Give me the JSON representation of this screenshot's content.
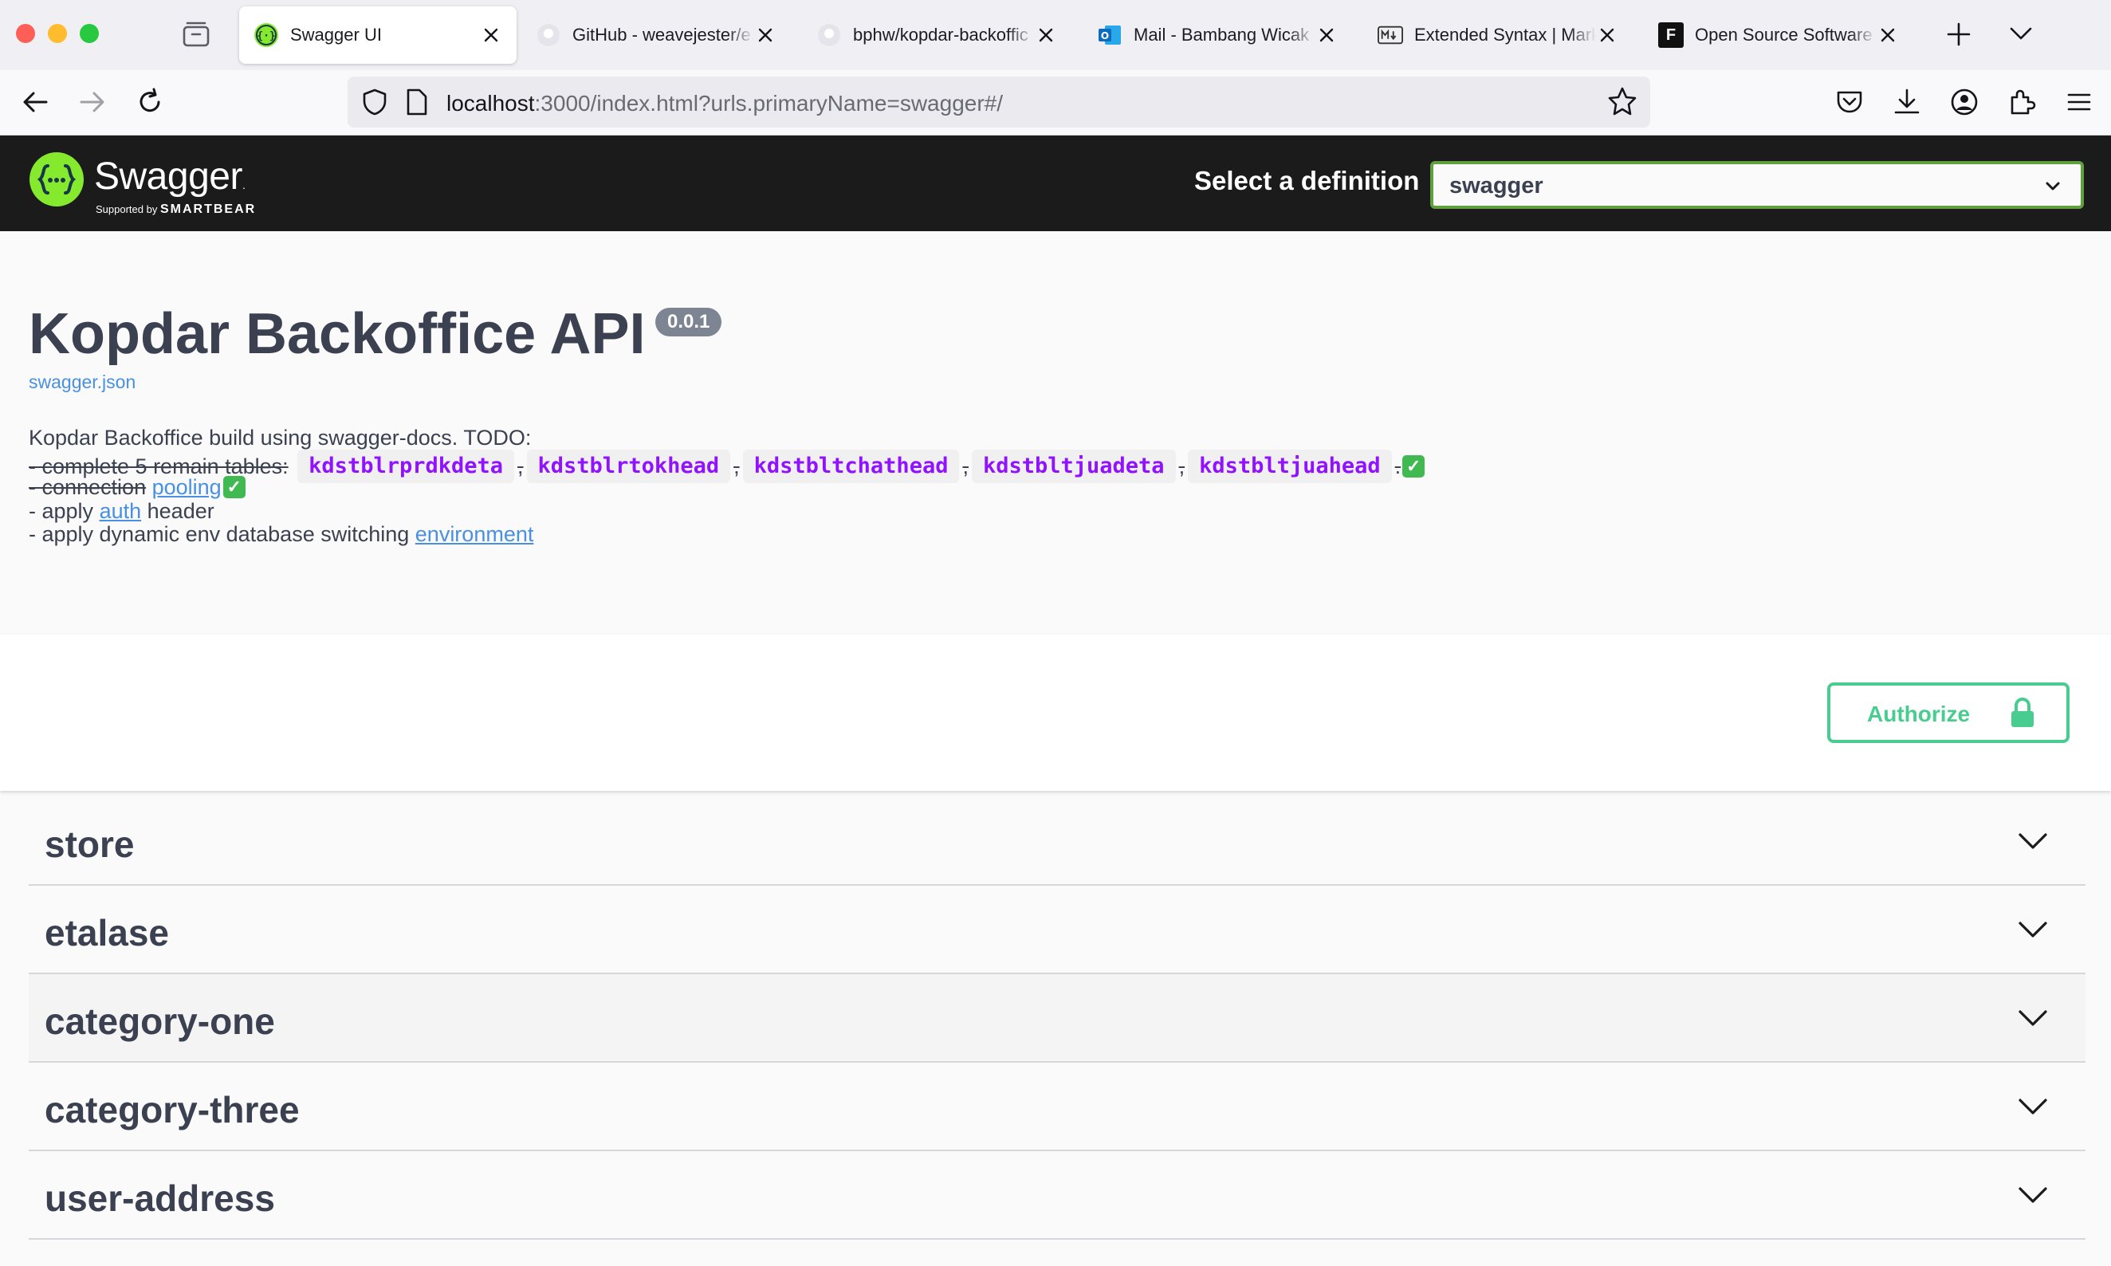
{
  "browser": {
    "tabs": [
      {
        "title": "Swagger UI",
        "favicon": "swagger-favicon",
        "active": true
      },
      {
        "title": "GitHub - weavejester/e",
        "favicon": "github-favicon"
      },
      {
        "title": "bphw/kopdar-backoffic",
        "favicon": "github-favicon"
      },
      {
        "title": "Mail - Bambang Wicak",
        "favicon": "outlook-favicon"
      },
      {
        "title": "Extended Syntax | Mark",
        "favicon": "markdown-favicon"
      },
      {
        "title": "Open Source Software",
        "favicon": "f-favicon",
        "favicon_letter": "F"
      }
    ],
    "url": {
      "host": "localhost",
      "rest": ":3000/index.html?urls.primaryName=swagger#/"
    }
  },
  "topbar": {
    "logo_text": "Swagger",
    "logo_tm": ".",
    "logo_sub_prefix": "Supported by",
    "logo_sub_brand": "SMARTBEAR",
    "definition_label": "Select a definition",
    "definition_value": "swagger"
  },
  "info": {
    "title": "Kopdar Backoffice API",
    "version": "0.0.1",
    "spec_link": "swagger.json",
    "description": {
      "line1": "Kopdar Backoffice build using swagger-docs. TODO:",
      "line2_text": "- complete 5 remain tables:",
      "tables": [
        "kdstblrprdkdeta",
        "kdstblrtokhead",
        "kdstbltchathead",
        "kdstbltjuadeta",
        "kdstbltjuahead"
      ],
      "separator": ",",
      "line2_end": ".",
      "line3_text": "- connection",
      "line3_link": "pooling",
      "line4_text": "- apply",
      "line4_link": "auth",
      "line4_end": "header",
      "line5_text": "- apply dynamic env database switching",
      "line5_link": "environment",
      "check": "✓"
    }
  },
  "authorize": {
    "label": "Authorize"
  },
  "tags": [
    {
      "name": "store",
      "highlighted": false
    },
    {
      "name": "etalase",
      "highlighted": false
    },
    {
      "name": "category-one",
      "highlighted": true
    },
    {
      "name": "category-three",
      "highlighted": false
    },
    {
      "name": "user-address",
      "highlighted": false
    }
  ],
  "colors": {
    "topbar_bg": "#1b1b1b",
    "swagger_green": "#85ea2d",
    "select_border": "#62a03f",
    "authorize_green": "#49cc90",
    "code_purple": "#9012fe",
    "link_blue": "#4990e2",
    "text_dark": "#3b4151"
  }
}
